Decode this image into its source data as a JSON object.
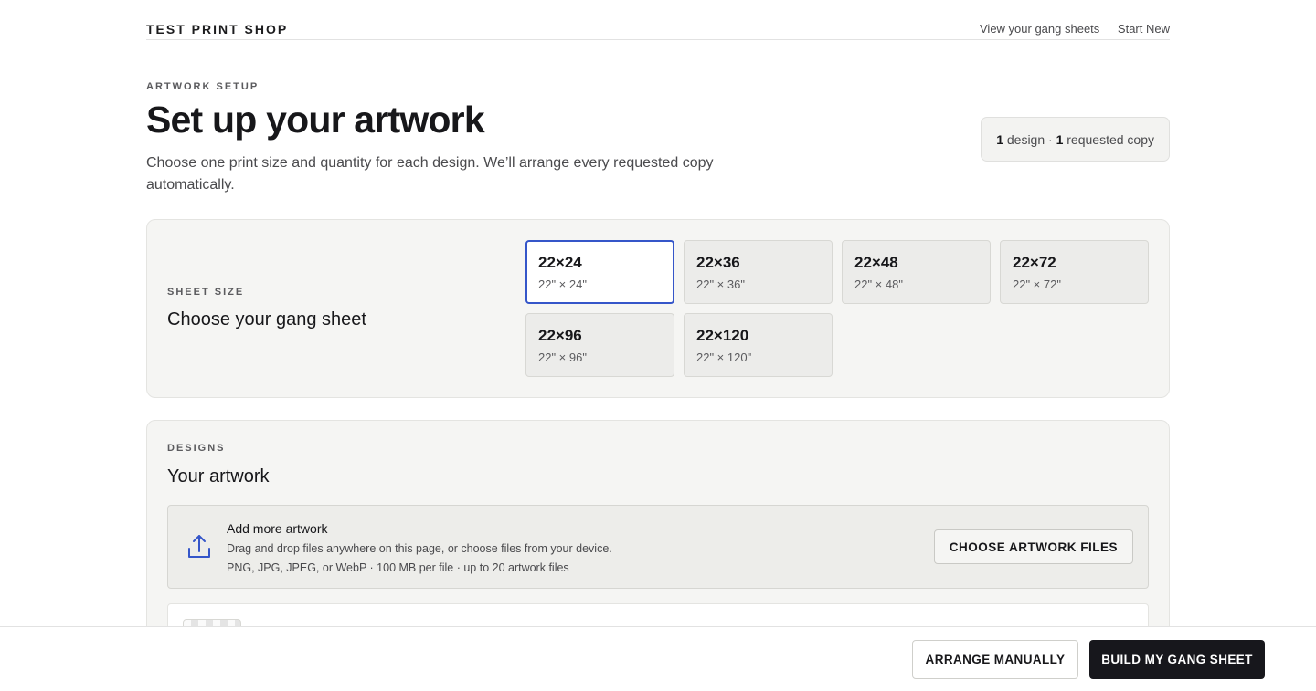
{
  "header": {
    "brand": "TEST PRINT SHOP",
    "nav": [
      "View your gang sheets",
      "Start New"
    ]
  },
  "intro": {
    "eyebrow": "ARTWORK SETUP",
    "title": "Set up your artwork",
    "subtitle": "Choose one print size and quantity for each design. We’ll arrange every requested copy automatically.",
    "summary": {
      "design_count": "1",
      "design_label": "design ·",
      "copy_count": "1",
      "copy_label": "requested copy"
    }
  },
  "sheet_size": {
    "label": "SHEET SIZE",
    "heading": "Choose your gang sheet",
    "options": [
      {
        "name": "22×24",
        "dims": "22\" × 24\"",
        "selected": true
      },
      {
        "name": "22×36",
        "dims": "22\" × 36\"",
        "selected": false
      },
      {
        "name": "22×48",
        "dims": "22\" × 48\"",
        "selected": false
      },
      {
        "name": "22×72",
        "dims": "22\" × 72\"",
        "selected": false
      },
      {
        "name": "22×96",
        "dims": "22\" × 96\"",
        "selected": false
      },
      {
        "name": "22×120",
        "dims": "22\" × 120\"",
        "selected": false
      }
    ]
  },
  "designs": {
    "label": "DESIGNS",
    "heading": "Your artwork",
    "upload": {
      "title": "Add more artwork",
      "description": "Drag and drop files anywhere on this page, or choose files from your device.",
      "meta": "PNG, JPG, JPEG, or WebP · 100 MB per file · up to 20 artwork files",
      "button": "CHOOSE ARTWORK FILES"
    }
  },
  "footer": {
    "arrange_label": "ARRANGE MANUALLY",
    "build_label": "BUILD MY GANG SHEET"
  },
  "colors": {
    "accent": "#3556c9",
    "primary_button": "#17171c",
    "panel_bg": "#f5f5f3"
  },
  "icons": {
    "upload": "upload-icon"
  }
}
